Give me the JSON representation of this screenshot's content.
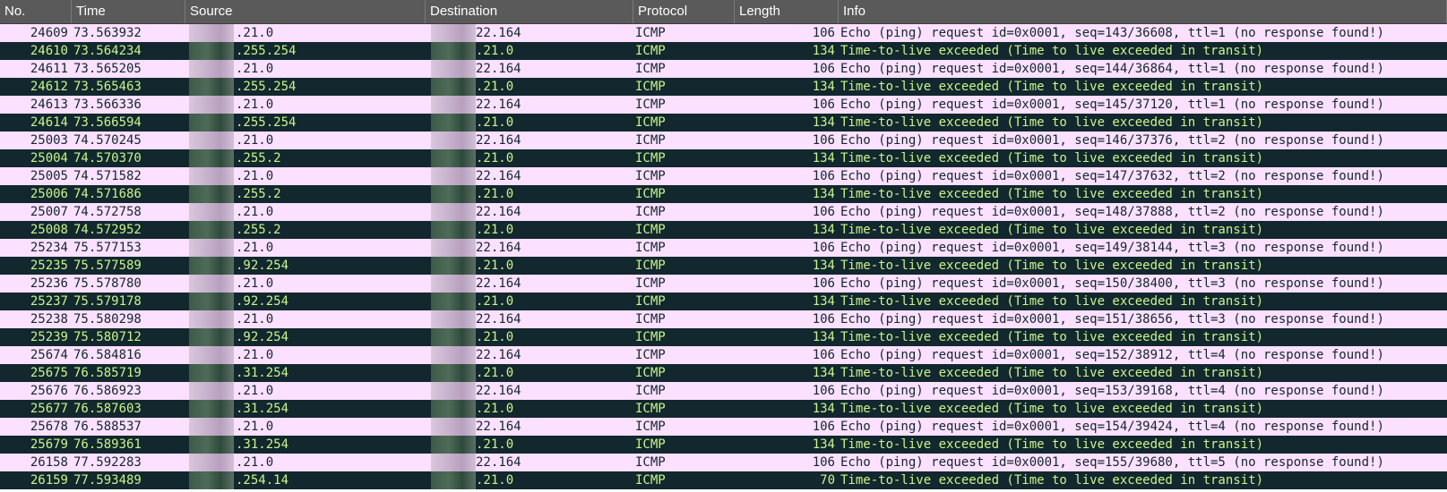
{
  "columns": {
    "no": "No.",
    "time": "Time",
    "source": "Source",
    "destination": "Destination",
    "protocol": "Protocol",
    "length": "Length",
    "info": "Info"
  },
  "colors": {
    "request_bg": "#fce0ff",
    "request_fg": "#12272e",
    "ttl_bg": "#12272e",
    "ttl_fg": "#c8f58a",
    "header_bg": "#5a5a5a"
  },
  "rows": [
    {
      "kind": "req",
      "no": "24609",
      "time": "73.563932",
      "source": ".21.0",
      "destination": "22.164",
      "protocol": "ICMP",
      "length": "106",
      "info": "Echo (ping) request  id=0x0001, seq=143/36608, ttl=1 (no response found!)"
    },
    {
      "kind": "ttl",
      "no": "24610",
      "time": "73.564234",
      "source": ".255.254",
      "destination": ".21.0",
      "protocol": "ICMP",
      "length": "134",
      "info": "Time-to-live exceeded (Time to live exceeded in transit)"
    },
    {
      "kind": "req",
      "no": "24611",
      "time": "73.565205",
      "source": ".21.0",
      "destination": "22.164",
      "protocol": "ICMP",
      "length": "106",
      "info": "Echo (ping) request  id=0x0001, seq=144/36864, ttl=1 (no response found!)"
    },
    {
      "kind": "ttl",
      "no": "24612",
      "time": "73.565463",
      "source": ".255.254",
      "destination": ".21.0",
      "protocol": "ICMP",
      "length": "134",
      "info": "Time-to-live exceeded (Time to live exceeded in transit)"
    },
    {
      "kind": "req",
      "no": "24613",
      "time": "73.566336",
      "source": ".21.0",
      "destination": "22.164",
      "protocol": "ICMP",
      "length": "106",
      "info": "Echo (ping) request  id=0x0001, seq=145/37120, ttl=1 (no response found!)"
    },
    {
      "kind": "ttl",
      "no": "24614",
      "time": "73.566594",
      "source": ".255.254",
      "destination": ".21.0",
      "protocol": "ICMP",
      "length": "134",
      "info": "Time-to-live exceeded (Time to live exceeded in transit)"
    },
    {
      "kind": "req",
      "no": "25003",
      "time": "74.570245",
      "source": ".21.0",
      "destination": "22.164",
      "protocol": "ICMP",
      "length": "106",
      "info": "Echo (ping) request  id=0x0001, seq=146/37376, ttl=2 (no response found!)"
    },
    {
      "kind": "ttl",
      "no": "25004",
      "time": "74.570370",
      "source": ".255.2",
      "destination": ".21.0",
      "protocol": "ICMP",
      "length": "134",
      "info": "Time-to-live exceeded (Time to live exceeded in transit)"
    },
    {
      "kind": "req",
      "no": "25005",
      "time": "74.571582",
      "source": ".21.0",
      "destination": "22.164",
      "protocol": "ICMP",
      "length": "106",
      "info": "Echo (ping) request  id=0x0001, seq=147/37632, ttl=2 (no response found!)"
    },
    {
      "kind": "ttl",
      "no": "25006",
      "time": "74.571686",
      "source": ".255.2",
      "destination": ".21.0",
      "protocol": "ICMP",
      "length": "134",
      "info": "Time-to-live exceeded (Time to live exceeded in transit)"
    },
    {
      "kind": "req",
      "no": "25007",
      "time": "74.572758",
      "source": ".21.0",
      "destination": "22.164",
      "protocol": "ICMP",
      "length": "106",
      "info": "Echo (ping) request  id=0x0001, seq=148/37888, ttl=2 (no response found!)"
    },
    {
      "kind": "ttl",
      "no": "25008",
      "time": "74.572952",
      "source": ".255.2",
      "destination": ".21.0",
      "protocol": "ICMP",
      "length": "134",
      "info": "Time-to-live exceeded (Time to live exceeded in transit)"
    },
    {
      "kind": "req",
      "no": "25234",
      "time": "75.577153",
      "source": ".21.0",
      "destination": "22.164",
      "protocol": "ICMP",
      "length": "106",
      "info": "Echo (ping) request  id=0x0001, seq=149/38144, ttl=3 (no response found!)"
    },
    {
      "kind": "ttl",
      "no": "25235",
      "time": "75.577589",
      "source": ".92.254",
      "destination": ".21.0",
      "protocol": "ICMP",
      "length": "134",
      "info": "Time-to-live exceeded (Time to live exceeded in transit)"
    },
    {
      "kind": "req",
      "no": "25236",
      "time": "75.578780",
      "source": ".21.0",
      "destination": "22.164",
      "protocol": "ICMP",
      "length": "106",
      "info": "Echo (ping) request  id=0x0001, seq=150/38400, ttl=3 (no response found!)"
    },
    {
      "kind": "ttl",
      "no": "25237",
      "time": "75.579178",
      "source": ".92.254",
      "destination": ".21.0",
      "protocol": "ICMP",
      "length": "134",
      "info": "Time-to-live exceeded (Time to live exceeded in transit)"
    },
    {
      "kind": "req",
      "no": "25238",
      "time": "75.580298",
      "source": ".21.0",
      "destination": "22.164",
      "protocol": "ICMP",
      "length": "106",
      "info": "Echo (ping) request  id=0x0001, seq=151/38656, ttl=3 (no response found!)"
    },
    {
      "kind": "ttl",
      "no": "25239",
      "time": "75.580712",
      "source": ".92.254",
      "destination": ".21.0",
      "protocol": "ICMP",
      "length": "134",
      "info": "Time-to-live exceeded (Time to live exceeded in transit)"
    },
    {
      "kind": "req",
      "no": "25674",
      "time": "76.584816",
      "source": ".21.0",
      "destination": "22.164",
      "protocol": "ICMP",
      "length": "106",
      "info": "Echo (ping) request  id=0x0001, seq=152/38912, ttl=4 (no response found!)"
    },
    {
      "kind": "ttl",
      "no": "25675",
      "time": "76.585719",
      "source": ".31.254",
      "destination": ".21.0",
      "protocol": "ICMP",
      "length": "134",
      "info": "Time-to-live exceeded (Time to live exceeded in transit)"
    },
    {
      "kind": "req",
      "no": "25676",
      "time": "76.586923",
      "source": ".21.0",
      "destination": "22.164",
      "protocol": "ICMP",
      "length": "106",
      "info": "Echo (ping) request  id=0x0001, seq=153/39168, ttl=4 (no response found!)"
    },
    {
      "kind": "ttl",
      "no": "25677",
      "time": "76.587603",
      "source": ".31.254",
      "destination": ".21.0",
      "protocol": "ICMP",
      "length": "134",
      "info": "Time-to-live exceeded (Time to live exceeded in transit)"
    },
    {
      "kind": "req",
      "no": "25678",
      "time": "76.588537",
      "source": ".21.0",
      "destination": "22.164",
      "protocol": "ICMP",
      "length": "106",
      "info": "Echo (ping) request  id=0x0001, seq=154/39424, ttl=4 (no response found!)"
    },
    {
      "kind": "ttl",
      "no": "25679",
      "time": "76.589361",
      "source": ".31.254",
      "destination": ".21.0",
      "protocol": "ICMP",
      "length": "134",
      "info": "Time-to-live exceeded (Time to live exceeded in transit)"
    },
    {
      "kind": "req",
      "no": "26158",
      "time": "77.592283",
      "source": ".21.0",
      "destination": "22.164",
      "protocol": "ICMP",
      "length": "106",
      "info": "Echo (ping) request  id=0x0001, seq=155/39680, ttl=5 (no response found!)"
    },
    {
      "kind": "ttl",
      "no": "26159",
      "time": "77.593489",
      "source": ".254.14",
      "destination": ".21.0",
      "protocol": "ICMP",
      "length": "70",
      "info": "Time-to-live exceeded (Time to live exceeded in transit)"
    }
  ]
}
